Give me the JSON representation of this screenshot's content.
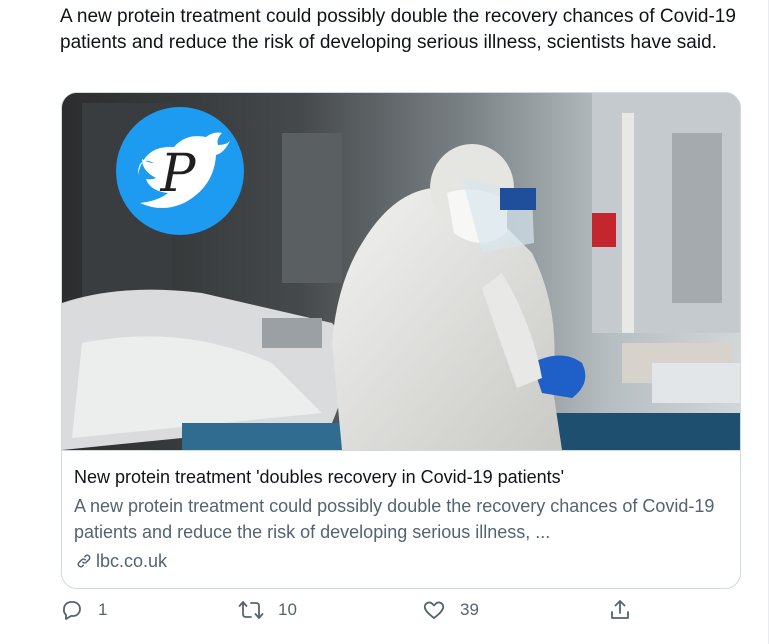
{
  "tweet": {
    "text": "A new protein treatment could possibly double the recovery chances of Covid-19 patients and reduce the risk of developing serious illness, scientists have said."
  },
  "card": {
    "title": "New protein treatment 'doubles recovery in Covid-19 patients'",
    "description": "A new protein treatment could possibly double the recovery chances of Covid-19 patients and reduce the risk of developing serious illness, ...",
    "domain": "lbc.co.uk",
    "logo_letter": "P"
  },
  "actions": {
    "replies": "1",
    "retweets": "10",
    "likes": "39"
  },
  "colors": {
    "twitter_blue": "#1d9bf0",
    "muted": "#536471",
    "border": "#cfd9de"
  }
}
